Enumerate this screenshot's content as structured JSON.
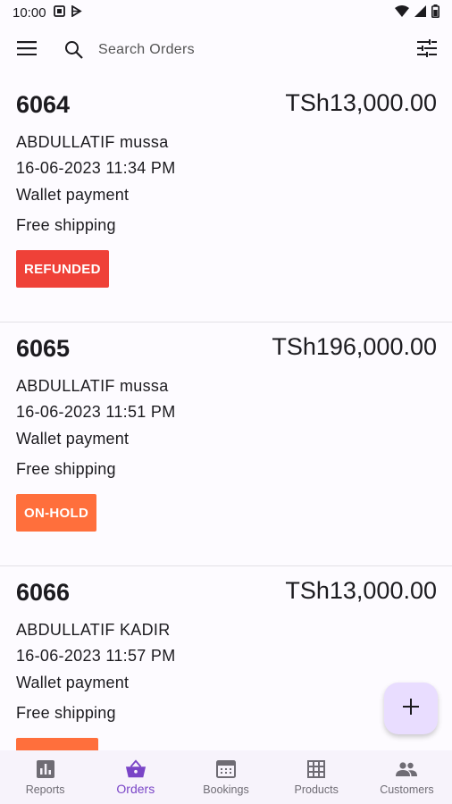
{
  "status_bar": {
    "time": "10:00",
    "left_icons": [
      "gallery-icon",
      "play-store-icon"
    ],
    "right_icons": [
      "wifi-icon",
      "signal-icon",
      "battery-icon"
    ]
  },
  "search": {
    "placeholder": "Search Orders",
    "value": ""
  },
  "orders": [
    {
      "number": "6064",
      "total": "TSh13,000.00",
      "customer": "ABDULLATIF mussa",
      "datetime": "16-06-2023  11:34 PM",
      "payment": "Wallet payment",
      "shipping": "Free shipping",
      "status": "REFUNDED",
      "status_color": "#ef4138"
    },
    {
      "number": "6065",
      "total": "TSh196,000.00",
      "customer": "ABDULLATIF mussa",
      "datetime": "16-06-2023  11:51 PM",
      "payment": "Wallet payment",
      "shipping": "Free shipping",
      "status": "ON-HOLD",
      "status_color": "#ff6f3c"
    },
    {
      "number": "6066",
      "total": "TSh13,000.00",
      "customer": "ABDULLATIF KADIR",
      "datetime": "16-06-2023  11:57 PM",
      "payment": "Wallet payment",
      "shipping": "Free shipping",
      "status": "",
      "status_color": "#ff6f3c"
    }
  ],
  "fab": {
    "icon": "plus-icon"
  },
  "bottom_nav": {
    "active": "Orders",
    "accent_color": "#7a45c7",
    "items": [
      {
        "label": "Reports",
        "icon": "bar-chart-icon"
      },
      {
        "label": "Orders",
        "icon": "basket-icon"
      },
      {
        "label": "Bookings",
        "icon": "calendar-icon"
      },
      {
        "label": "Products",
        "icon": "grid-icon"
      },
      {
        "label": "Customers",
        "icon": "people-icon"
      }
    ]
  }
}
